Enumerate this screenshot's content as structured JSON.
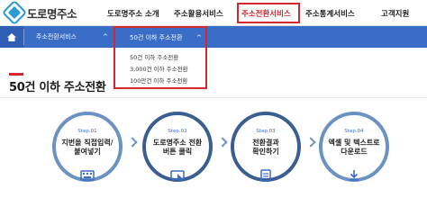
{
  "logo": {
    "text": "도로명주소",
    "icon": "road-address-logo-icon"
  },
  "nav": {
    "items": [
      {
        "label": "도로명주소 소개"
      },
      {
        "label": "주소활용서비스"
      },
      {
        "label": "주소전환서비스"
      },
      {
        "label": "주소통계서비스"
      },
      {
        "label": "고객지원"
      }
    ],
    "active_index": 2
  },
  "breadcrumb": {
    "home_icon": "home-icon",
    "section": "주소전환서비스",
    "current": "50건 이하 주소전환",
    "caret": "^"
  },
  "dropdown": {
    "options": [
      "50건 이하 주소전환",
      "3,000건 이하 주소전환",
      "100만건 이하 주소전환"
    ]
  },
  "page": {
    "title": "50건 이하 주소전환"
  },
  "steps": [
    {
      "num": "Step.01",
      "text1": "지번을 직접입력/",
      "text2": "붙여넣기",
      "icon": "keyboard-icon"
    },
    {
      "num": "Step.02",
      "text1": "도로명주소 전환",
      "text2": "버튼 클릭",
      "icon": "cursor-click-icon"
    },
    {
      "num": "Step.03",
      "text1": "전환결과",
      "text2": "확인하기",
      "icon": "result-document-icon"
    },
    {
      "num": "Step.04",
      "text1": "엑셀 및 텍스트로",
      "text2": "다운로드",
      "icon": "download-icon"
    }
  ],
  "colors": {
    "accent_red": "#d6262e",
    "subbar_blue": "#3a6dc6",
    "step_border_light": "#6b92c2",
    "step_border_dark": "#3a5e91",
    "logo_blue": "#2b9bd6"
  }
}
